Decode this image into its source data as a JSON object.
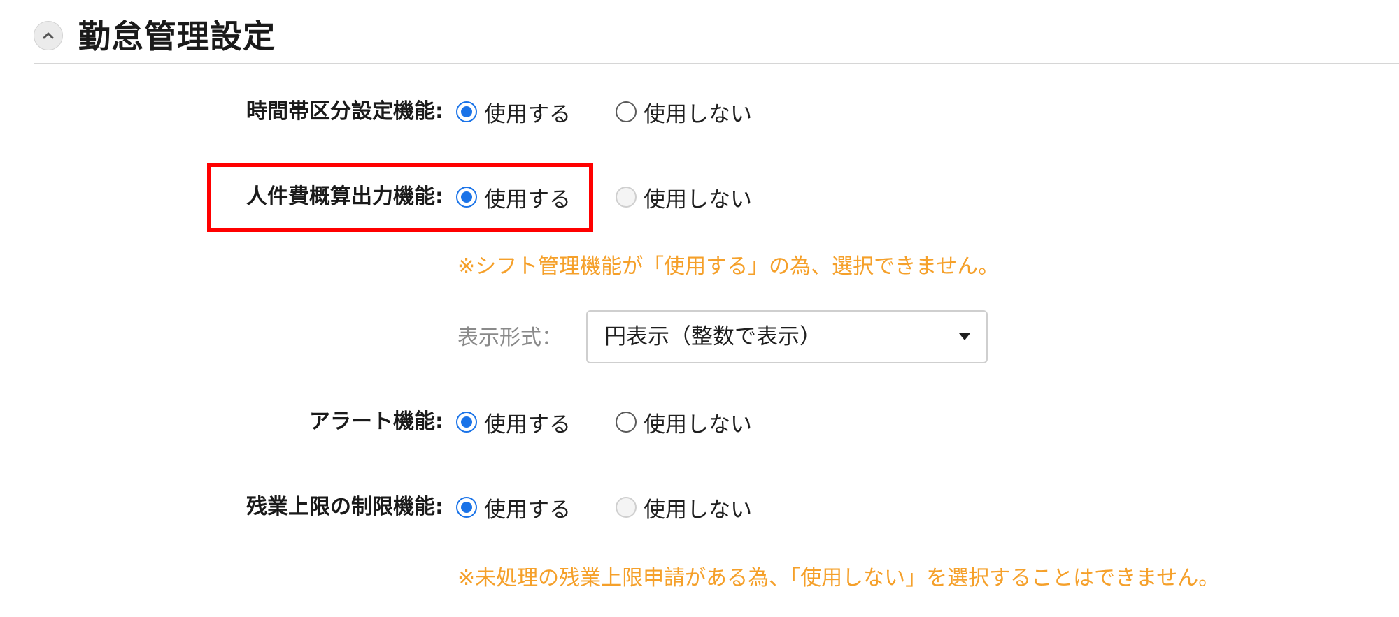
{
  "section": {
    "title": "勤怠管理設定"
  },
  "settings": [
    {
      "label": "時間帯区分設定機能:",
      "use_label": "使用する",
      "nouse_label": "使用しない",
      "selected": "use",
      "nouse_disabled": false
    },
    {
      "label": "人件費概算出力機能:",
      "use_label": "使用する",
      "nouse_label": "使用しない",
      "selected": "use",
      "nouse_disabled": true,
      "notice": "※シフト管理機能が「使用する」の為、選択できません。",
      "format_label": "表示形式：",
      "format_value": "円表示（整数で表示）"
    },
    {
      "label": "アラート機能:",
      "use_label": "使用する",
      "nouse_label": "使用しない",
      "selected": "use",
      "nouse_disabled": false
    },
    {
      "label": "残業上限の制限機能:",
      "use_label": "使用する",
      "nouse_label": "使用しない",
      "selected": "use",
      "nouse_disabled": true,
      "notice": "※未処理の残業上限申請がある為、「使用しない」を選択することはできません。"
    }
  ],
  "colors": {
    "accent": "#1a73e8",
    "notice": "#f5a02a",
    "highlight": "#ff0000"
  },
  "icons": {
    "collapse": "chevron-up-icon",
    "dropdown": "caret-down-icon"
  }
}
